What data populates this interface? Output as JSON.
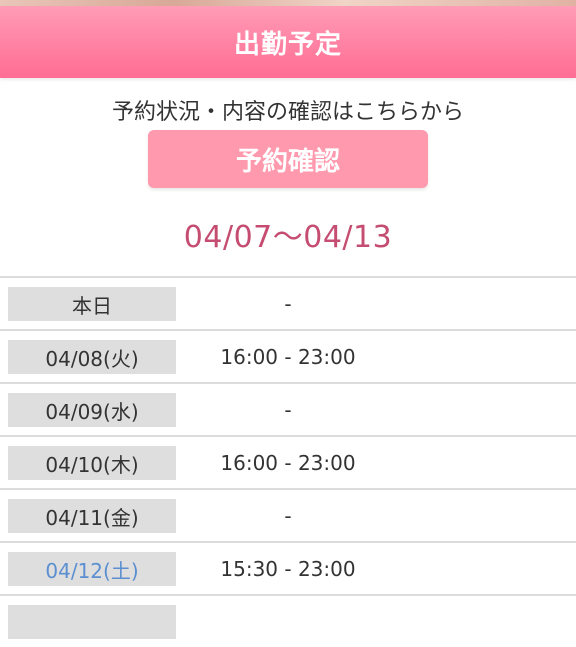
{
  "header": {
    "title": "出勤予定"
  },
  "reservation": {
    "info_text": "予約状況・内容の確認はこちらから",
    "button_label": "予約確認"
  },
  "week_range": "04/07〜04/13",
  "schedule": [
    {
      "date": "本日",
      "time": "-"
    },
    {
      "date": "04/08(火)",
      "time": "16:00 - 23:00"
    },
    {
      "date": "04/09(水)",
      "time": "-"
    },
    {
      "date": "04/10(木)",
      "time": "16:00 - 23:00"
    },
    {
      "date": "04/11(金)",
      "time": "-"
    },
    {
      "date": "04/12(土)",
      "time": "15:30 - 23:00"
    }
  ],
  "colors": {
    "header_pink": "#ff86a6",
    "button_pink": "#ff9aae",
    "range_text": "#c54d72",
    "saturday_blue": "#5b8fd0",
    "date_cell_bg": "#dedede"
  }
}
